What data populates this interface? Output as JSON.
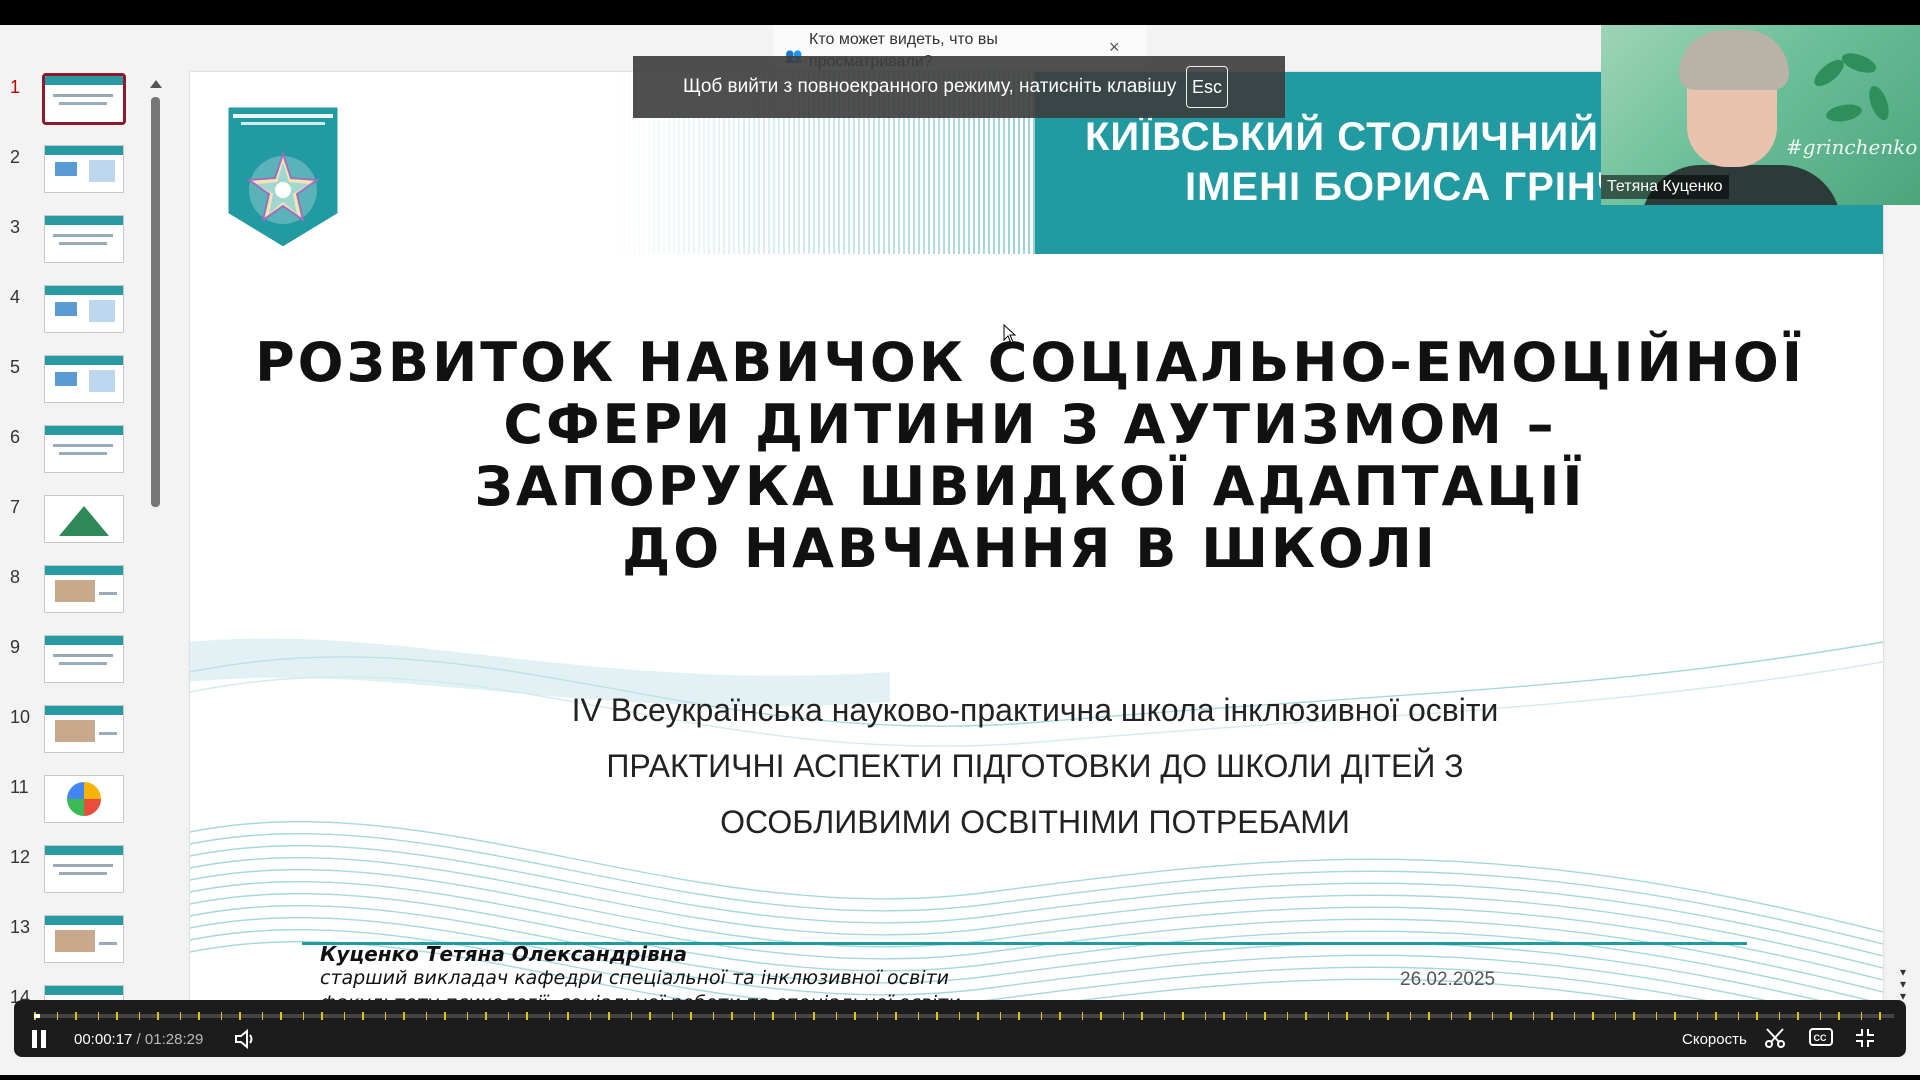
{
  "privacy_popup": {
    "text": "Кто может видеть, что вы просматривали?",
    "close_icon": "×"
  },
  "fullscreen_toast": {
    "text": "Щоб вийти з повноекранного режиму, натисніть клавішу",
    "key": "Esc"
  },
  "participant_video": {
    "name": "Тетяна Куценко",
    "background_tag": "#grinchenko"
  },
  "sidebar": {
    "slides": [
      {
        "number": "1"
      },
      {
        "number": "2"
      },
      {
        "number": "3"
      },
      {
        "number": "4"
      },
      {
        "number": "5"
      },
      {
        "number": "6"
      },
      {
        "number": "7"
      },
      {
        "number": "8"
      },
      {
        "number": "9"
      },
      {
        "number": "10"
      },
      {
        "number": "11"
      },
      {
        "number": "12"
      },
      {
        "number": "13"
      },
      {
        "number": "14"
      }
    ],
    "active_slide": "1"
  },
  "slide": {
    "header_line1": "КИЇВСЬКИЙ СТОЛИЧНИЙ УНІВЕРСИТЕТ",
    "header_line2": "ІМЕНІ БОРИСА ГРІНЧЕНКА",
    "title_lines": [
      "РОЗВИТОК НАВИЧОК СОЦІАЛЬНО-ЕМОЦІЙНОЇ",
      "СФЕРИ ДИТИНИ З АУТИЗМОМ –",
      "ЗАПОРУКА ШВИДКОЇ АДАПТАЦІЇ",
      "ДО НАВЧАННЯ В ШКОЛІ"
    ],
    "subtitle_lines": [
      "IV Всеукраїнська науково-практична школа інклюзивної освіти",
      "ПРАКТИЧНІ АСПЕКТИ ПІДГОТОВКИ ДО ШКОЛИ ДІТЕЙ З",
      "ОСОБЛИВИМИ ОСВІТНІМИ ПОТРЕБАМИ"
    ],
    "author": "Куценко Тетяна Олександрівна",
    "author_position": "старший викладач кафедри спеціальної та інклюзивної освіти",
    "author_faculty": "факультету психології, соціальної роботи та спеціальної освіти",
    "date": "26.02.2025"
  },
  "player": {
    "current_time": "00:00:17",
    "separator": " / ",
    "duration": "01:28:29",
    "speed_label": "Скорость",
    "progress_fraction": 0.0032
  },
  "colors": {
    "accent_teal": "#229aa1",
    "active_thumb_border": "#8b1a2e"
  }
}
